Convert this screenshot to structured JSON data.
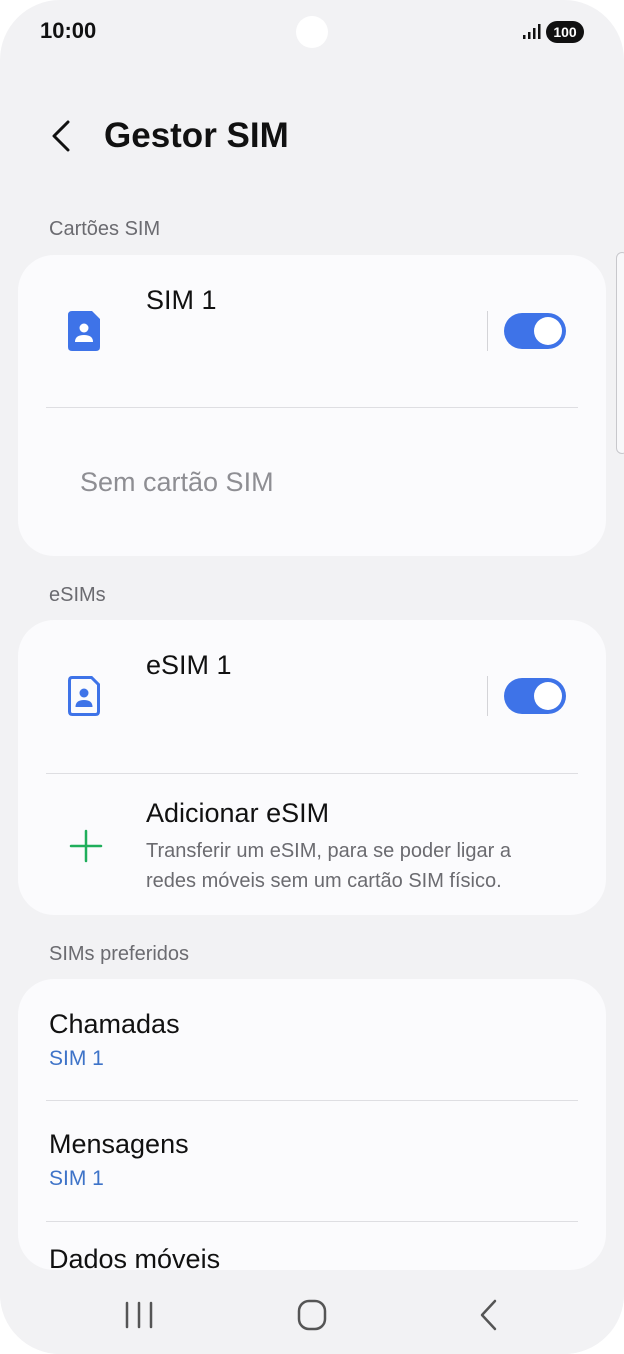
{
  "status_bar": {
    "time": "10:00",
    "battery": "100"
  },
  "header": {
    "title": "Gestor SIM",
    "back_icon": "chevron-left-icon"
  },
  "sections": {
    "sim_cards": {
      "label": "Cartões SIM",
      "sim1_name": "SIM 1",
      "sim1_enabled": true,
      "no_sim_text": "Sem cartão SIM"
    },
    "esims": {
      "label": "eSIMs",
      "esim1_name": "eSIM 1",
      "esim1_enabled": true,
      "add_title": "Adicionar eSIM",
      "add_desc_line1": "Transferir um eSIM, para se poder ligar a",
      "add_desc_line2": "redes móveis sem um cartão SIM físico."
    },
    "preferred": {
      "label": "SIMs preferidos",
      "items": [
        {
          "title": "Chamadas",
          "value": "SIM 1"
        },
        {
          "title": "Mensagens",
          "value": "SIM 1"
        },
        {
          "title": "Dados móveis",
          "value": ""
        }
      ]
    }
  },
  "colors": {
    "accent": "#3e73e8",
    "plus_green": "#1fae5b",
    "background": "#f2f2f4",
    "card": "#fbfbfd"
  },
  "nav": {
    "recents_icon": "recents-icon",
    "home_icon": "home-icon",
    "back_icon": "back-icon"
  }
}
